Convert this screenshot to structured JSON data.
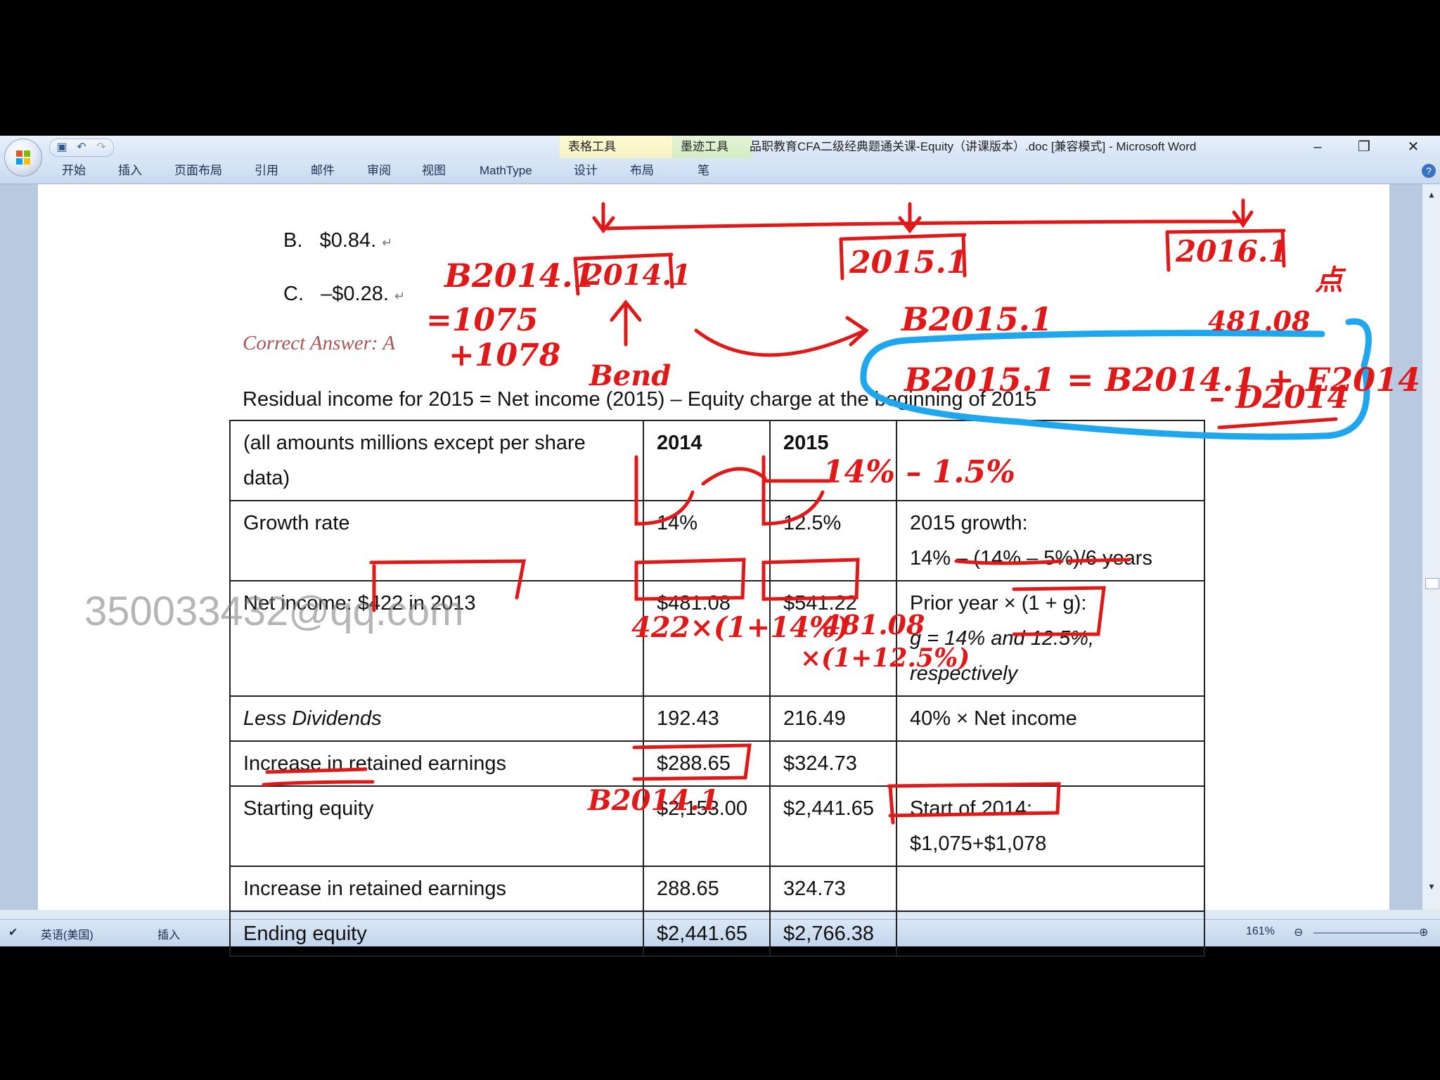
{
  "window": {
    "title": "品职教育CFA二级经典题通关课-Equity（讲课版本）.doc [兼容模式] - Microsoft Word",
    "context_tab_table": "表格工具",
    "context_tab_ink": "墨迹工具",
    "controls": {
      "minimize": "–",
      "restore": "❐",
      "close": "✕"
    }
  },
  "ribbon": {
    "tabs": [
      "开始",
      "插入",
      "页面布局",
      "引用",
      "邮件",
      "审阅",
      "视图",
      "MathType",
      "设计",
      "布局",
      "笔"
    ]
  },
  "document": {
    "options": [
      {
        "label": "B.",
        "value": "$0.84."
      },
      {
        "label": "C.",
        "value": "–$0.28."
      }
    ],
    "correct_answer": "Correct Answer: A",
    "residual_line": "Residual income for 2015 = Net income (2015) – Equity charge at the beginning of 2015",
    "table": {
      "header": [
        "(all amounts millions except per share data)",
        "2014",
        "2015",
        ""
      ],
      "rows": [
        {
          "label": "Growth rate",
          "y2014": "14%",
          "y2015": "12.5%",
          "note1": "2015 growth:",
          "note2": "14% – (14% – 5%)/6 years"
        },
        {
          "label": "Net income: $422 in 2013",
          "y2014": "$481.08",
          "y2015": "$541.22",
          "note1": "Prior year × (1 + g):",
          "note2": "g = 14% and 12.5%,",
          "note3": "respectively"
        },
        {
          "label": "Less Dividends",
          "y2014": "192.43",
          "y2015": "216.49",
          "note1": "40% × Net income"
        },
        {
          "label": "Increase in retained earnings",
          "y2014": "$288.65",
          "y2015": "$324.73",
          "note1": ""
        },
        {
          "label": "Starting equity",
          "y2014": "$2,153.00",
          "y2015": "$2,441.65",
          "note1": "Start of 2014:",
          "note2": "$1,075+$1,078"
        },
        {
          "label": "Increase in retained earnings",
          "y2014": "288.65",
          "y2015": "324.73",
          "note1": ""
        },
        {
          "label": "Ending equity",
          "y2014": "$2,441.65",
          "y2015": "$2,766.38",
          "note1": ""
        }
      ]
    },
    "watermark": "350033432@qq.com"
  },
  "ink": {
    "labels": {
      "b2014_1": "B2014.1",
      "eq1075": "=1075",
      "plus1078": "+1078",
      "box2014": "2014.1",
      "box2015": "2015.1",
      "box2016": "2016.1",
      "bend": "Bend",
      "b2015": "B2015.1",
      "v48108": "481.08",
      "formula": "B2015.1 = B2014.1 + E2014",
      "formula2": "– D2014",
      "growth_note": "14% – 1.5%",
      "calc1": "422×(1+14%)",
      "calc2": "481.08",
      "calc3": "×(1+12.5%)",
      "b2014_below": "B2014.1",
      "corner": "点"
    },
    "colors": {
      "red": "#e01818",
      "blue": "#1ea7ef"
    }
  },
  "statusbar": {
    "language": "英语(美国)",
    "mode": "插入",
    "zoom": "161%"
  }
}
